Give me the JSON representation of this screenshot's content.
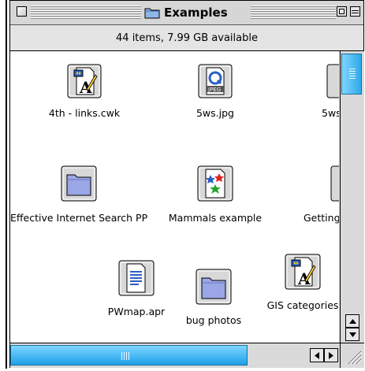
{
  "window": {
    "title": "Examples",
    "status": "44 items, 7.99 GB available"
  },
  "items": [
    {
      "label": "4th - links.cwk",
      "icon": "appleworks-doc-icon"
    },
    {
      "label": "5ws.jpg",
      "icon": "jpeg-file-icon"
    },
    {
      "label": "5ws",
      "icon": "document-icon"
    },
    {
      "label": "Effective Internet Search PP",
      "icon": "folder-icon"
    },
    {
      "label": "Mammals example",
      "icon": "image-file-icon"
    },
    {
      "label": "Getting",
      "icon": "document-icon"
    },
    {
      "label": "PWmap.apr",
      "icon": "text-file-icon"
    },
    {
      "label": "bug photos",
      "icon": "folder-icon"
    },
    {
      "label": "GIS categories",
      "icon": "appleworks-doc-icon"
    }
  ],
  "colors": {
    "scroll_thumb": "#2fa8e8",
    "folder": "#9aa6e6",
    "window_bg": "#dcdcdc"
  }
}
